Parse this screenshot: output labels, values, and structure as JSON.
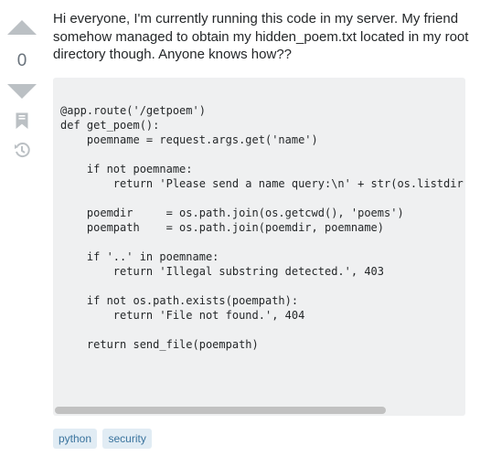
{
  "vote": {
    "count": "0",
    "up_icon": "caret-up-icon",
    "down_icon": "caret-down-icon",
    "bookmark_icon": "bookmark-icon",
    "history_icon": "history-icon"
  },
  "post": {
    "body": "Hi everyone, I'm currently running this code in my server. My friend somehow managed to obtain my hidden_poem.txt located in my root directory though. Anyone knows how??",
    "code": "@app.route('/getpoem')\ndef get_poem():\n    poemname = request.args.get('name')\n\n    if not poemname:\n        return 'Please send a name query:\\n' + str(os.listdir(\n\n    poemdir     = os.path.join(os.getcwd(), 'poems')\n    poempath    = os.path.join(poemdir, poemname)\n\n    if '..' in poemname:\n        return 'Illegal substring detected.', 403\n\n    if not os.path.exists(poempath):\n        return 'File not found.', 404\n\n    return send_file(poempath)"
  },
  "tags": [
    "python",
    "security"
  ],
  "colors": {
    "vote_arrow": "#bbc0c4",
    "code_bg": "#eff0f1",
    "tag_bg": "#e1ecf4",
    "tag_text": "#39739d"
  }
}
